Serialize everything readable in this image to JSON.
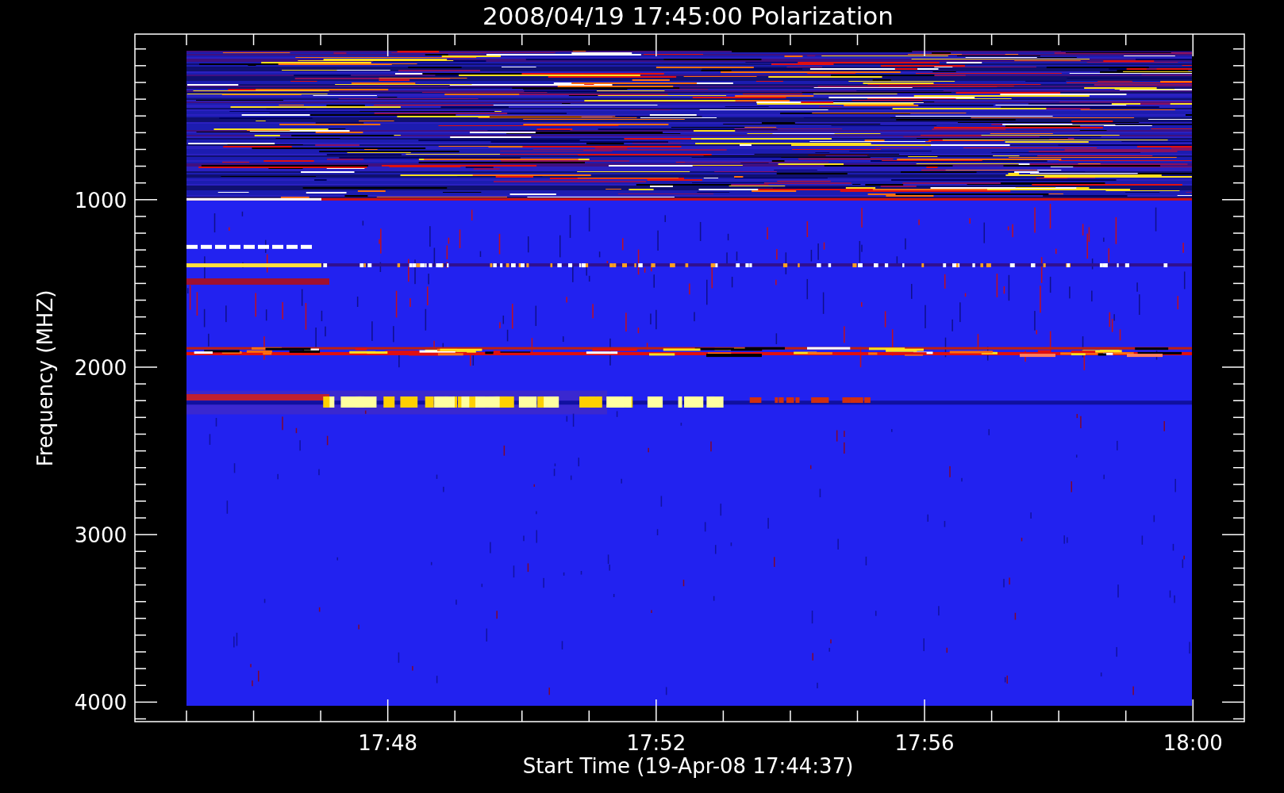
{
  "title": "2008/04/19 17:45:00 Polarization",
  "x_axis": {
    "label": "Start Time (19-Apr-08 17:44:37)",
    "tick_labels": [
      "17:48",
      "17:52",
      "17:56",
      "18:00"
    ]
  },
  "y_axis": {
    "label": "Frequency (MHZ)",
    "tick_labels": [
      "1000",
      "2000",
      "3000",
      "4000"
    ]
  }
}
